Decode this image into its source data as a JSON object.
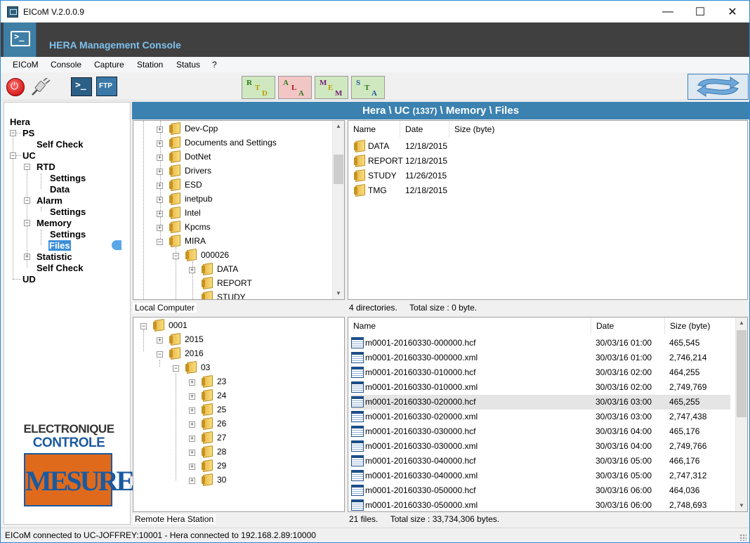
{
  "window": {
    "title": "EICoM V.2.0.0.9",
    "minimize": "—",
    "maximize": "☐",
    "close": "✕"
  },
  "banner": {
    "title": "HERA Management Console"
  },
  "menu": [
    "EICoM",
    "Console",
    "Capture",
    "Station",
    "Status",
    "?"
  ],
  "toolbar": {
    "term_label": ">_",
    "ftp_label": "FTP",
    "modes": [
      {
        "name": "rtd",
        "letters": [
          "R",
          "T",
          "D"
        ],
        "bg": "#cfe8c0",
        "colors": [
          "#2a7a1a",
          "#b9a000",
          "#b9a000"
        ]
      },
      {
        "name": "ala",
        "letters": [
          "A",
          "L",
          "A"
        ],
        "bg": "#f3c6c6",
        "colors": [
          "#2a7a1a",
          "#b01010",
          "#2a7a1a"
        ]
      },
      {
        "name": "mem",
        "letters": [
          "M",
          "E",
          "M"
        ],
        "bg": "#cfe8c0",
        "colors": [
          "#7a1a7a",
          "#b9a000",
          "#7a1a7a"
        ]
      },
      {
        "name": "sta",
        "letters": [
          "S",
          "T",
          "A"
        ],
        "bg": "#cfe8c0",
        "colors": [
          "#1a5a9a",
          "#2a7a1a",
          "#1a5a9a"
        ]
      }
    ]
  },
  "nav": {
    "hera": "Hera",
    "ps": "PS",
    "ps_selfcheck": "Self Check",
    "uc": "UC",
    "rtd": "RTD",
    "rtd_settings": "Settings",
    "rtd_data": "Data",
    "alarm": "Alarm",
    "alarm_settings": "Settings",
    "memory": "Memory",
    "memory_settings": "Settings",
    "memory_files": "Files",
    "statistic": "Statistic",
    "uc_selfcheck": "Self Check",
    "ud": "UD"
  },
  "logo": {
    "line1": "ELECTRONIQUE",
    "line2": "CONTROLE",
    "line3": "MESURE"
  },
  "path": {
    "prefix": "Hera \\ UC",
    "id": "(1337)",
    "suffix": "\\ Memory \\ Files"
  },
  "local_tree": {
    "items": [
      "Dev-Cpp",
      "Documents and Settings",
      "DotNet",
      "Drivers",
      "ESD",
      "inetpub",
      "Intel",
      "Kpcms",
      "MIRA",
      "000026",
      "DATA",
      "REPORT",
      "STUDY"
    ],
    "label": "Local Computer"
  },
  "local_list": {
    "columns": [
      "Name",
      "Date",
      "Size (byte)"
    ],
    "rows": [
      {
        "name": "DATA",
        "date": "12/18/2015"
      },
      {
        "name": "REPORT",
        "date": "12/18/2015"
      },
      {
        "name": "STUDY",
        "date": "11/26/2015"
      },
      {
        "name": "TMG",
        "date": "12/18/2015"
      }
    ],
    "status_count": "4 directories.",
    "status_size": "Total size : 0 byte."
  },
  "remote_tree": {
    "items": [
      "0001",
      "2015",
      "2016",
      "03",
      "23",
      "24",
      "25",
      "26",
      "27",
      "28",
      "29",
      "30"
    ],
    "label": "Remote Hera Station"
  },
  "remote_list": {
    "columns": [
      "Name",
      "Date",
      "Size (byte)"
    ],
    "rows": [
      {
        "name": "m0001-20160330-000000.hcf",
        "date": "30/03/16  01:00",
        "size": "465,545"
      },
      {
        "name": "m0001-20160330-000000.xml",
        "date": "30/03/16  01:00",
        "size": "2,746,214"
      },
      {
        "name": "m0001-20160330-010000.hcf",
        "date": "30/03/16  02:00",
        "size": "464,255"
      },
      {
        "name": "m0001-20160330-010000.xml",
        "date": "30/03/16  02:00",
        "size": "2,749,769"
      },
      {
        "name": "m0001-20160330-020000.hcf",
        "date": "30/03/16  03:00",
        "size": "465,255"
      },
      {
        "name": "m0001-20160330-020000.xml",
        "date": "30/03/16  03:00",
        "size": "2,747,438"
      },
      {
        "name": "m0001-20160330-030000.hcf",
        "date": "30/03/16  04:00",
        "size": "465,176"
      },
      {
        "name": "m0001-20160330-030000.xml",
        "date": "30/03/16  04:00",
        "size": "2,749,766"
      },
      {
        "name": "m0001-20160330-040000.hcf",
        "date": "30/03/16  05:00",
        "size": "466,176"
      },
      {
        "name": "m0001-20160330-040000.xml",
        "date": "30/03/16  05:00",
        "size": "2,747,312"
      },
      {
        "name": "m0001-20160330-050000.hcf",
        "date": "30/03/16  06:00",
        "size": "464,036"
      },
      {
        "name": "m0001-20160330-050000.xml",
        "date": "30/03/16  06:00",
        "size": "2,748,693"
      }
    ],
    "status_count": "21 files.",
    "status_size": "Total size : 33,734,306 bytes."
  },
  "statusbar": "EICoM connected to UC-JOFFREY:10001  -  Hera connected to 192.168.2.89:10000"
}
